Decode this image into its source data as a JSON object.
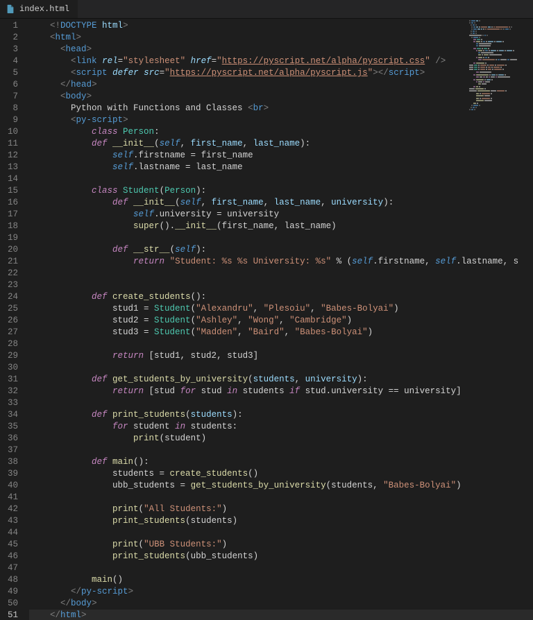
{
  "tab": {
    "filename": "index.html"
  },
  "line_count": 51,
  "active_line": 51,
  "lines": {
    "l1": [
      [
        "<!",
        "gray"
      ],
      [
        "DOCTYPE ",
        "tag"
      ],
      [
        "html",
        "attr"
      ],
      [
        ">",
        "gray"
      ]
    ],
    "l2": [
      [
        "<",
        "gray"
      ],
      [
        "html",
        "tag"
      ],
      [
        ">",
        "gray"
      ]
    ],
    "l3": [
      [
        "  ",
        ""
      ],
      [
        "<",
        "gray"
      ],
      [
        "head",
        "tag"
      ],
      [
        ">",
        "gray"
      ]
    ],
    "l4": [
      [
        "    ",
        ""
      ],
      [
        "<",
        "gray"
      ],
      [
        "link ",
        "tag"
      ],
      [
        "rel",
        "attr ital"
      ],
      [
        "=",
        "plain"
      ],
      [
        "\"stylesheet\"",
        "str"
      ],
      [
        " ",
        ""
      ],
      [
        "href",
        "attr ital"
      ],
      [
        "=",
        "plain"
      ],
      [
        "\"",
        "str"
      ],
      [
        "https://pyscript.net/alpha/pyscript.css",
        "str-u"
      ],
      [
        "\"",
        "str"
      ],
      [
        " />",
        "gray"
      ]
    ],
    "l5": [
      [
        "    ",
        ""
      ],
      [
        "<",
        "gray"
      ],
      [
        "script ",
        "tag"
      ],
      [
        "defer ",
        "attr ital"
      ],
      [
        "src",
        "attr ital"
      ],
      [
        "=",
        "plain"
      ],
      [
        "\"",
        "str"
      ],
      [
        "https://pyscript.net/alpha/pyscript.js",
        "str-u"
      ],
      [
        "\"",
        "str"
      ],
      [
        "></",
        "gray"
      ],
      [
        "script",
        "tag"
      ],
      [
        ">",
        "gray"
      ]
    ],
    "l6": [
      [
        "  ",
        ""
      ],
      [
        "</",
        "gray"
      ],
      [
        "head",
        "tag"
      ],
      [
        ">",
        "gray"
      ]
    ],
    "l7": [
      [
        "  ",
        ""
      ],
      [
        "<",
        "gray"
      ],
      [
        "body",
        "tag"
      ],
      [
        ">",
        "gray"
      ]
    ],
    "l8": [
      [
        "    Python with Functions and Classes ",
        "plain"
      ],
      [
        "<",
        "gray"
      ],
      [
        "br",
        "tag"
      ],
      [
        ">",
        "gray"
      ]
    ],
    "l9": [
      [
        "    ",
        ""
      ],
      [
        "<",
        "gray"
      ],
      [
        "py-script",
        "tag"
      ],
      [
        ">",
        "gray"
      ]
    ],
    "l10": [
      [
        "        ",
        ""
      ],
      [
        "class ",
        "kw"
      ],
      [
        "Person",
        "cls"
      ],
      [
        ":",
        "plain"
      ]
    ],
    "l11": [
      [
        "        ",
        ""
      ],
      [
        "def ",
        "kw"
      ],
      [
        "__init__",
        "fn"
      ],
      [
        "(",
        "plain"
      ],
      [
        "self",
        "self"
      ],
      [
        ", ",
        "plain"
      ],
      [
        "first_name",
        "attr"
      ],
      [
        ", ",
        "plain"
      ],
      [
        "last_name",
        "attr"
      ],
      [
        "):",
        "plain"
      ]
    ],
    "l12": [
      [
        "            ",
        ""
      ],
      [
        "self",
        "self"
      ],
      [
        ".firstname = first_name",
        "plain"
      ]
    ],
    "l13": [
      [
        "            ",
        ""
      ],
      [
        "self",
        "self"
      ],
      [
        ".lastname = last_name",
        "plain"
      ]
    ],
    "l14": [
      [
        "",
        ""
      ]
    ],
    "l15": [
      [
        "        ",
        ""
      ],
      [
        "class ",
        "kw"
      ],
      [
        "Student",
        "cls"
      ],
      [
        "(",
        "plain"
      ],
      [
        "Person",
        "cls"
      ],
      [
        "):",
        "plain"
      ]
    ],
    "l16": [
      [
        "            ",
        ""
      ],
      [
        "def ",
        "kw"
      ],
      [
        "__init__",
        "fn"
      ],
      [
        "(",
        "plain"
      ],
      [
        "self",
        "self"
      ],
      [
        ", ",
        "plain"
      ],
      [
        "first_name",
        "attr"
      ],
      [
        ", ",
        "plain"
      ],
      [
        "last_name",
        "attr"
      ],
      [
        ", ",
        "plain"
      ],
      [
        "university",
        "attr"
      ],
      [
        "):",
        "plain"
      ]
    ],
    "l17": [
      [
        "                ",
        ""
      ],
      [
        "self",
        "self"
      ],
      [
        ".university = university",
        "plain"
      ]
    ],
    "l18": [
      [
        "                ",
        ""
      ],
      [
        "super",
        "fn"
      ],
      [
        "().",
        "plain"
      ],
      [
        "__init__",
        "fn"
      ],
      [
        "(first_name, last_name)",
        "plain"
      ]
    ],
    "l19": [
      [
        "",
        ""
      ]
    ],
    "l20": [
      [
        "            ",
        ""
      ],
      [
        "def ",
        "kw"
      ],
      [
        "__str__",
        "fn"
      ],
      [
        "(",
        "plain"
      ],
      [
        "self",
        "self"
      ],
      [
        "):",
        "plain"
      ]
    ],
    "l21": [
      [
        "                ",
        ""
      ],
      [
        "return ",
        "kw"
      ],
      [
        "\"Student: %s %s University: %s\"",
        "str"
      ],
      [
        " % (",
        "plain"
      ],
      [
        "self",
        "self"
      ],
      [
        ".firstname, ",
        "plain"
      ],
      [
        "self",
        "self"
      ],
      [
        ".lastname, s",
        "plain"
      ]
    ],
    "l22": [
      [
        "",
        ""
      ]
    ],
    "l23": [
      [
        "",
        ""
      ]
    ],
    "l24": [
      [
        "        ",
        ""
      ],
      [
        "def ",
        "kw"
      ],
      [
        "create_students",
        "fn"
      ],
      [
        "():",
        "plain"
      ]
    ],
    "l25": [
      [
        "            stud1 = ",
        "plain"
      ],
      [
        "Student",
        "cls"
      ],
      [
        "(",
        "plain"
      ],
      [
        "\"Alexandru\"",
        "str"
      ],
      [
        ", ",
        "plain"
      ],
      [
        "\"Plesoiu\"",
        "str"
      ],
      [
        ", ",
        "plain"
      ],
      [
        "\"Babes-Bolyai\"",
        "str"
      ],
      [
        ")",
        "plain"
      ]
    ],
    "l26": [
      [
        "            stud2 = ",
        "plain"
      ],
      [
        "Student",
        "cls"
      ],
      [
        "(",
        "plain"
      ],
      [
        "\"Ashley\"",
        "str"
      ],
      [
        ", ",
        "plain"
      ],
      [
        "\"Wong\"",
        "str"
      ],
      [
        ", ",
        "plain"
      ],
      [
        "\"Cambridge\"",
        "str"
      ],
      [
        ")",
        "plain"
      ]
    ],
    "l27": [
      [
        "            stud3 = ",
        "plain"
      ],
      [
        "Student",
        "cls"
      ],
      [
        "(",
        "plain"
      ],
      [
        "\"Madden\"",
        "str"
      ],
      [
        ", ",
        "plain"
      ],
      [
        "\"Baird\"",
        "str"
      ],
      [
        ", ",
        "plain"
      ],
      [
        "\"Babes-Bolyai\"",
        "str"
      ],
      [
        ")",
        "plain"
      ]
    ],
    "l28": [
      [
        "",
        ""
      ]
    ],
    "l29": [
      [
        "            ",
        ""
      ],
      [
        "return ",
        "kw"
      ],
      [
        "[stud1, stud2, stud3]",
        "plain"
      ]
    ],
    "l30": [
      [
        "",
        ""
      ]
    ],
    "l31": [
      [
        "        ",
        ""
      ],
      [
        "def ",
        "kw"
      ],
      [
        "get_students_by_university",
        "fn"
      ],
      [
        "(",
        "plain"
      ],
      [
        "students",
        "attr"
      ],
      [
        ", ",
        "plain"
      ],
      [
        "university",
        "attr"
      ],
      [
        "):",
        "plain"
      ]
    ],
    "l32": [
      [
        "            ",
        ""
      ],
      [
        "return ",
        "kw"
      ],
      [
        "[stud ",
        "plain"
      ],
      [
        "for ",
        "kw"
      ],
      [
        "stud ",
        "plain"
      ],
      [
        "in ",
        "kw"
      ],
      [
        "students ",
        "plain"
      ],
      [
        "if ",
        "kw"
      ],
      [
        "stud.university == university]",
        "plain"
      ]
    ],
    "l33": [
      [
        "",
        ""
      ]
    ],
    "l34": [
      [
        "        ",
        ""
      ],
      [
        "def ",
        "kw"
      ],
      [
        "print_students",
        "fn"
      ],
      [
        "(",
        "plain"
      ],
      [
        "students",
        "attr"
      ],
      [
        "):",
        "plain"
      ]
    ],
    "l35": [
      [
        "            ",
        ""
      ],
      [
        "for ",
        "kw"
      ],
      [
        "student ",
        "plain"
      ],
      [
        "in ",
        "kw"
      ],
      [
        "students:",
        "plain"
      ]
    ],
    "l36": [
      [
        "                ",
        ""
      ],
      [
        "print",
        "fn"
      ],
      [
        "(student)",
        "plain"
      ]
    ],
    "l37": [
      [
        "",
        ""
      ]
    ],
    "l38": [
      [
        "        ",
        ""
      ],
      [
        "def ",
        "kw"
      ],
      [
        "main",
        "fn"
      ],
      [
        "():",
        "plain"
      ]
    ],
    "l39": [
      [
        "            students = ",
        "plain"
      ],
      [
        "create_students",
        "fn"
      ],
      [
        "()",
        "plain"
      ]
    ],
    "l40": [
      [
        "            ubb_students = ",
        "plain"
      ],
      [
        "get_students_by_university",
        "fn"
      ],
      [
        "(students, ",
        "plain"
      ],
      [
        "\"Babes-Bolyai\"",
        "str"
      ],
      [
        ")",
        "plain"
      ]
    ],
    "l41": [
      [
        "",
        ""
      ]
    ],
    "l42": [
      [
        "            ",
        ""
      ],
      [
        "print",
        "fn"
      ],
      [
        "(",
        "plain"
      ],
      [
        "\"All Students:\"",
        "str"
      ],
      [
        ")",
        "plain"
      ]
    ],
    "l43": [
      [
        "            ",
        ""
      ],
      [
        "print_students",
        "fn"
      ],
      [
        "(students)",
        "plain"
      ]
    ],
    "l44": [
      [
        "",
        ""
      ]
    ],
    "l45": [
      [
        "            ",
        ""
      ],
      [
        "print",
        "fn"
      ],
      [
        "(",
        "plain"
      ],
      [
        "\"UBB Students:\"",
        "str"
      ],
      [
        ")",
        "plain"
      ]
    ],
    "l46": [
      [
        "            ",
        ""
      ],
      [
        "print_students",
        "fn"
      ],
      [
        "(ubb_students)",
        "plain"
      ]
    ],
    "l47": [
      [
        "",
        ""
      ]
    ],
    "l48": [
      [
        "        ",
        ""
      ],
      [
        "main",
        "fn"
      ],
      [
        "()",
        "plain"
      ]
    ],
    "l49": [
      [
        "    ",
        ""
      ],
      [
        "</",
        "gray"
      ],
      [
        "py-script",
        "tag"
      ],
      [
        ">",
        "gray"
      ]
    ],
    "l50": [
      [
        "  ",
        ""
      ],
      [
        "</",
        "gray"
      ],
      [
        "body",
        "tag"
      ],
      [
        ">",
        "gray"
      ]
    ],
    "l51": [
      [
        "</",
        "gray"
      ],
      [
        "html",
        "tag"
      ],
      [
        ">",
        "gray"
      ]
    ]
  },
  "colors": {
    "gray": "#808080",
    "tag": "#569cd6",
    "attr": "#9cdcfe",
    "str": "#ce9178",
    "kw": "#c586c0",
    "cls": "#4ec9b0",
    "fn": "#dcdcaa",
    "plain": "#d4d4d4",
    "self": "#569cd6"
  }
}
